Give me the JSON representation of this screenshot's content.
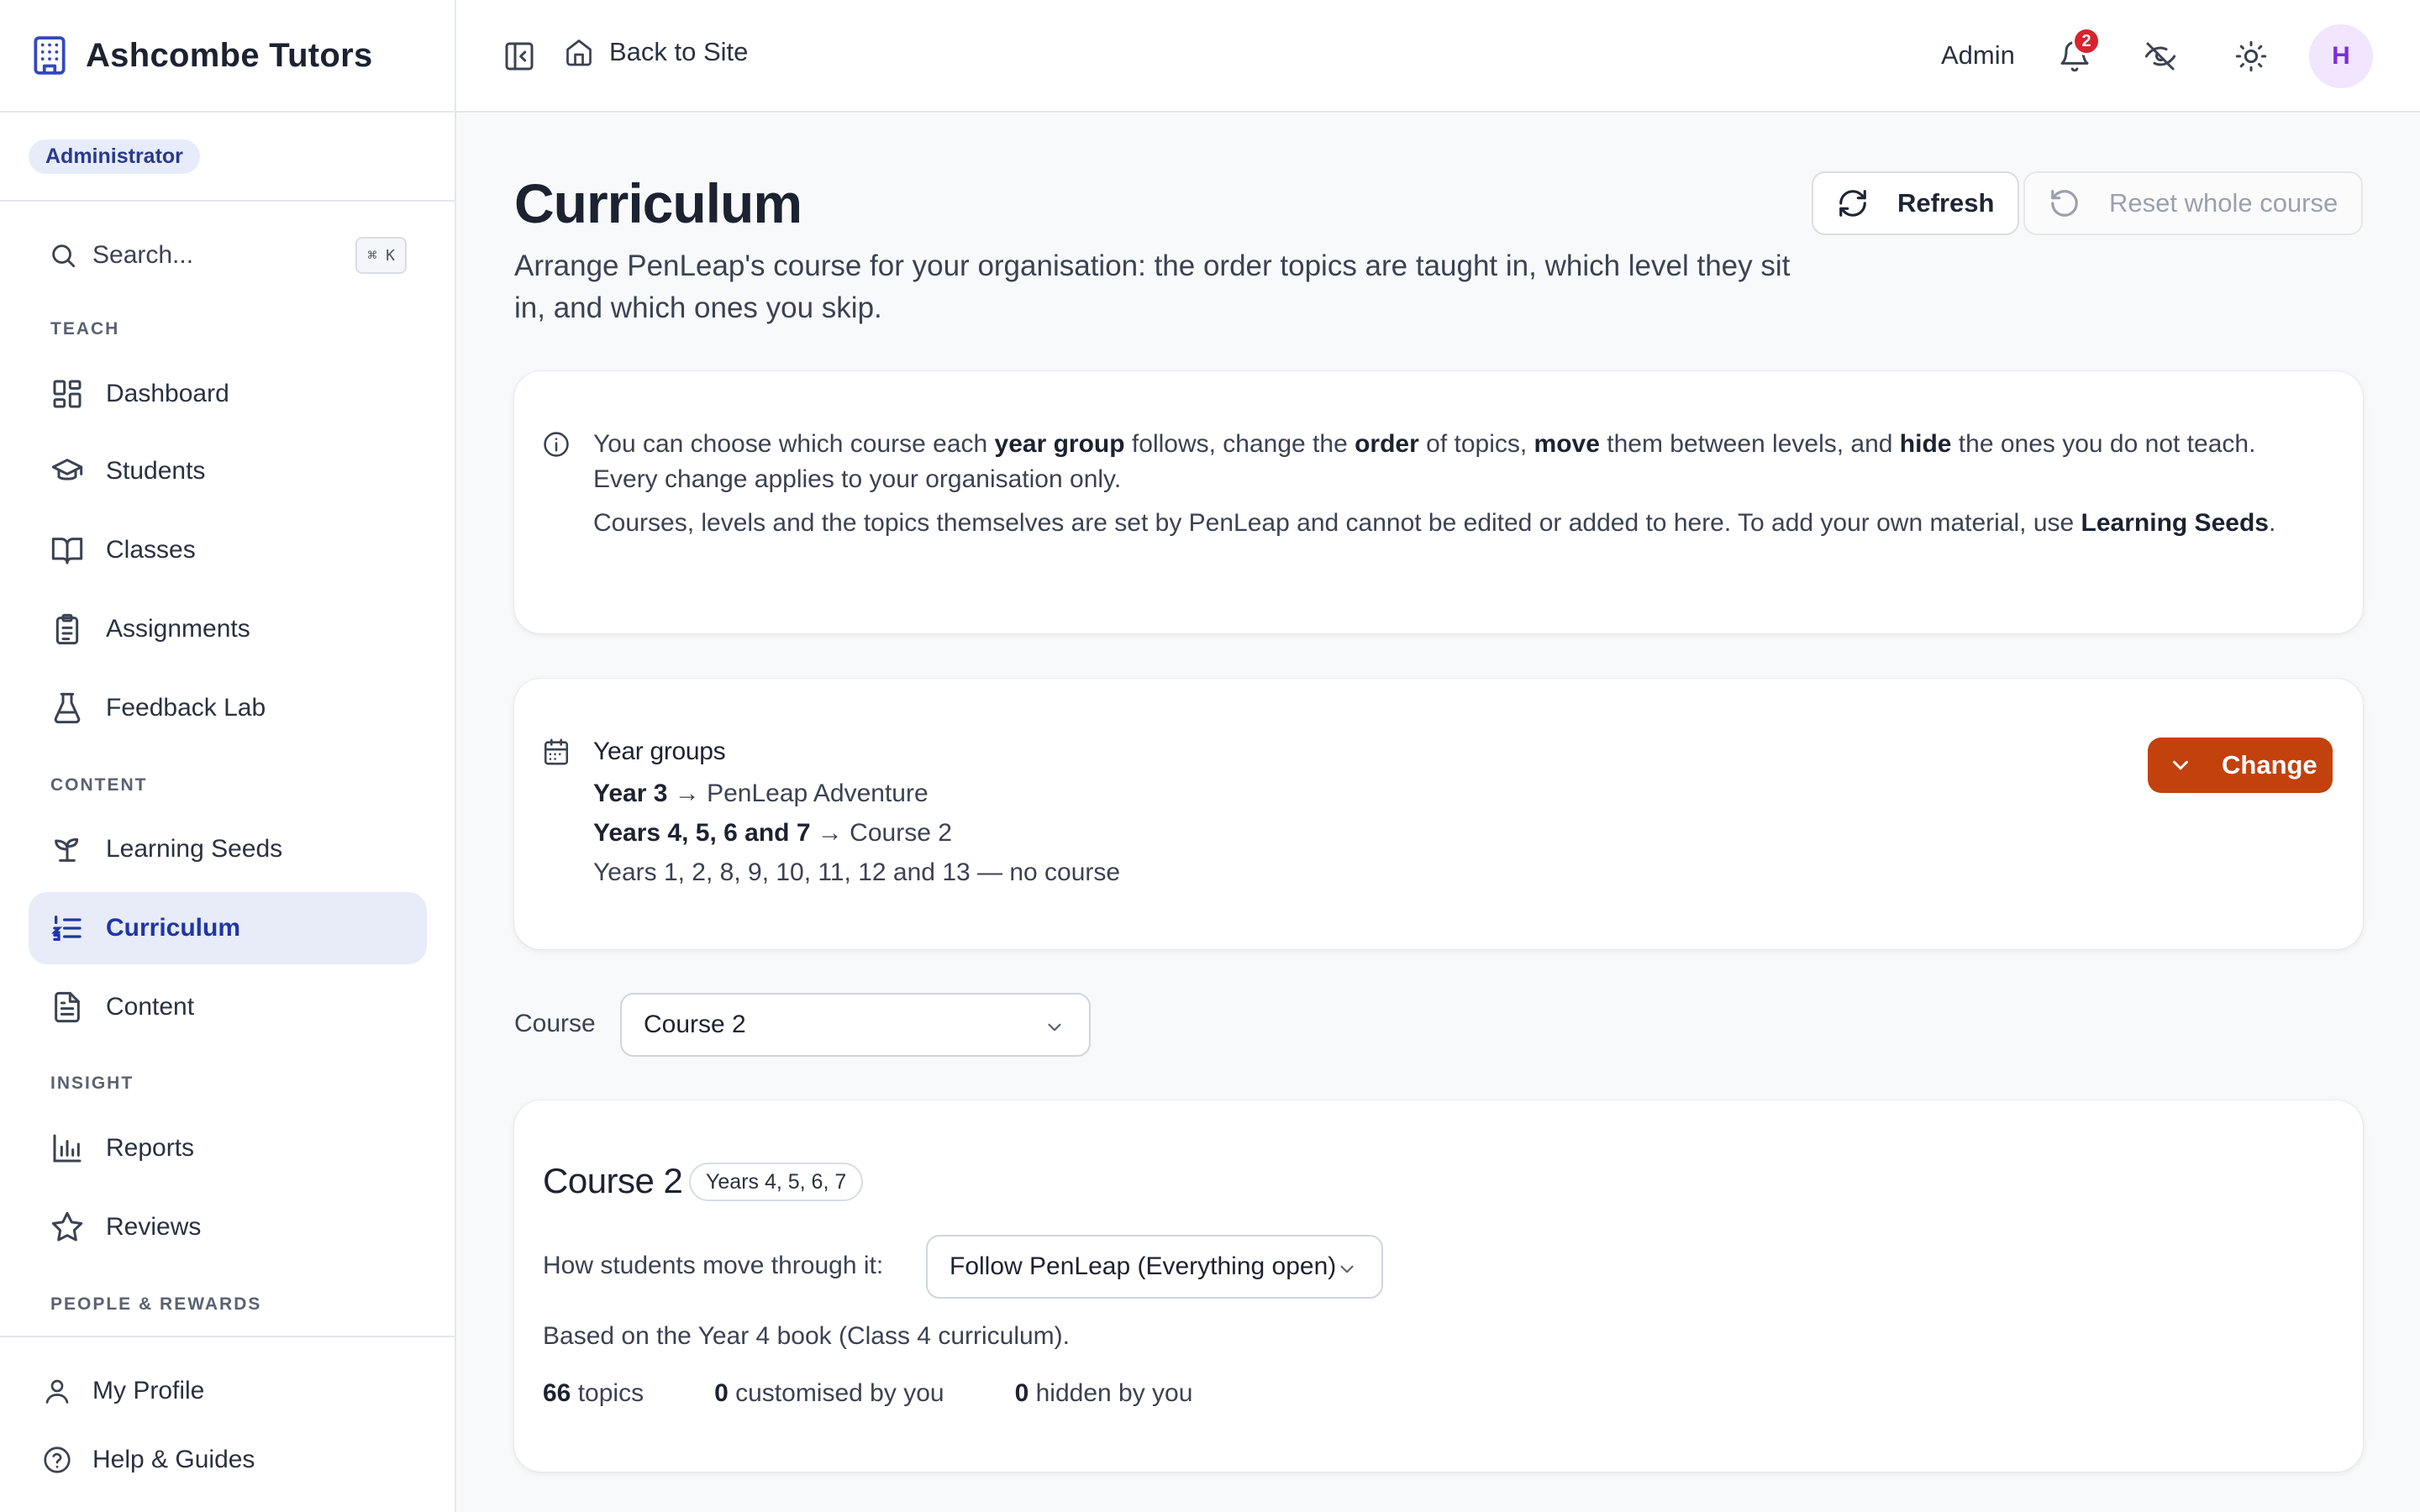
{
  "app": {
    "brand": "Ashcombe Tutors",
    "role": "Administrator"
  },
  "sidebar": {
    "search_label": "Search...",
    "search_shortcut": "⌘ K",
    "sections": {
      "teach": "TEACH",
      "content": "CONTENT",
      "insight": "INSIGHT",
      "people": "PEOPLE & REWARDS"
    },
    "items": [
      {
        "label": "Dashboard",
        "icon": "dashboard-icon"
      },
      {
        "label": "Students",
        "icon": "graduation-cap-icon"
      },
      {
        "label": "Classes",
        "icon": "book-open-icon"
      },
      {
        "label": "Assignments",
        "icon": "clipboard-icon"
      },
      {
        "label": "Feedback Lab",
        "icon": "flask-icon"
      },
      {
        "label": "Learning Seeds",
        "icon": "sprout-icon"
      },
      {
        "label": "Curriculum",
        "icon": "list-ordered-icon",
        "active": true
      },
      {
        "label": "Content",
        "icon": "file-text-icon"
      },
      {
        "label": "Reports",
        "icon": "bar-chart-icon"
      },
      {
        "label": "Reviews",
        "icon": "star-icon"
      }
    ],
    "footer": [
      {
        "label": "My Profile",
        "icon": "user-icon"
      },
      {
        "label": "Help & Guides",
        "icon": "help-circle-icon"
      }
    ]
  },
  "topbar": {
    "back_label": "Back to Site",
    "user_label": "Admin",
    "notification_count": "2",
    "avatar_initial": "H"
  },
  "page": {
    "title": "Curriculum",
    "subtitle": "Arrange PenLeap's course for your organisation: the order topics are taught in, which level they sit in, and which ones you skip.",
    "refresh_label": "Refresh",
    "reset_label": "Reset whole course"
  },
  "info": {
    "p1": [
      {
        "t": "You can choose which course each "
      },
      {
        "t": "year group",
        "b": true
      },
      {
        "t": " follows, change the "
      },
      {
        "t": "order",
        "b": true
      },
      {
        "t": " of topics, "
      },
      {
        "t": "move",
        "b": true
      },
      {
        "t": " them between levels, and "
      },
      {
        "t": "hide",
        "b": true
      },
      {
        "t": " the ones you do not teach. Every change applies to your organisation only."
      }
    ],
    "p2": [
      {
        "t": "Courses, levels and the topics themselves are set by PenLeap and cannot be edited or added to here. To add your own material, use "
      },
      {
        "t": "Learning Seeds",
        "b": true
      },
      {
        "t": "."
      }
    ]
  },
  "year_groups": {
    "title": "Year groups",
    "change_label": "Change",
    "lines": [
      {
        "years": "Year 3",
        "course": " → PenLeap Adventure"
      },
      {
        "years": "Years 4, 5, 6 and 7",
        "course": " → Course 2"
      },
      {
        "years": "",
        "course": "Years 1, 2, 8, 9, 10, 11, 12 and 13 — no course"
      }
    ]
  },
  "course_picker": {
    "label": "Course",
    "selected": "Course 2"
  },
  "course": {
    "title": "Course 2",
    "years_badge": "Years 4, 5, 6, 7",
    "progression_label": "How students move through it:",
    "progression_value": "Follow PenLeap (Everything open)",
    "based_on": "Based on the Year 4 book (Class 4 curriculum).",
    "stats": [
      {
        "n": "66",
        "label": " topics"
      },
      {
        "n": "0",
        "label": " customised by you"
      },
      {
        "n": "0",
        "label": " hidden by you"
      }
    ]
  },
  "colors": {
    "accent": "#2036a6",
    "primary_action": "#c2410c",
    "notification": "#d9232e"
  }
}
